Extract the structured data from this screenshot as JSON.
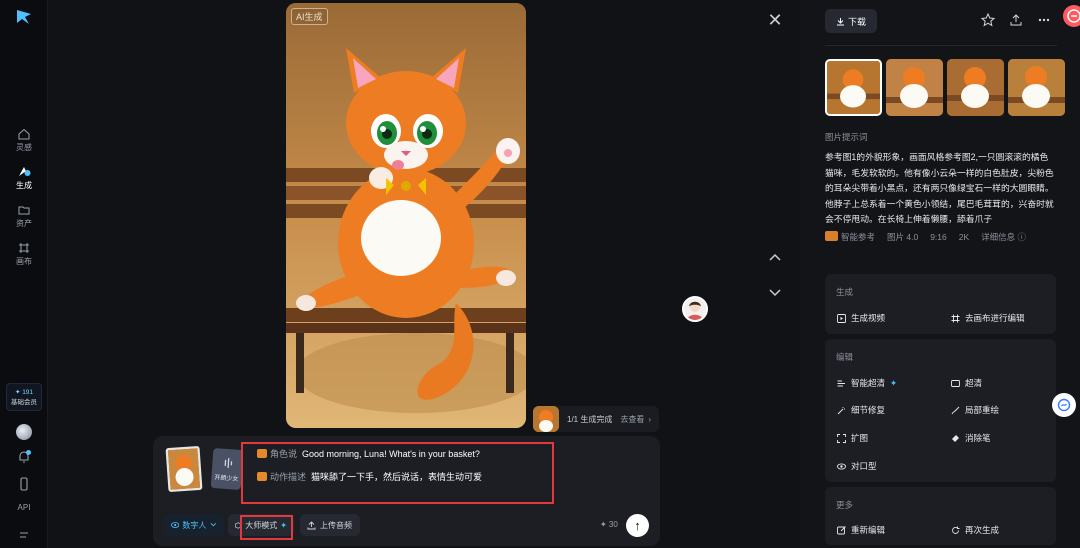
{
  "sidebar": {
    "items": [
      {
        "label": "灵感",
        "icon": "home-icon"
      },
      {
        "label": "生成",
        "icon": "generate-icon"
      },
      {
        "label": "资产",
        "icon": "folder-icon"
      },
      {
        "label": "画布",
        "icon": "canvas-icon"
      }
    ],
    "vip_points": "✦ 191",
    "vip_label": "基础会员",
    "api_label": "API"
  },
  "stage": {
    "ai_tag": "AI生成",
    "close_icon": "close-icon",
    "gen_status": {
      "text": "1/1 生成完成",
      "link": "去查看",
      "chevron": "›"
    }
  },
  "input_panel": {
    "audio_file_label": "开朗少女",
    "prompt_lines": [
      {
        "label": "角色说",
        "text": "Good morning, Luna! What's in your basket?"
      },
      {
        "label": "动作描述",
        "text": "猫咪舔了一下手，然后说话，表情生动可爱"
      }
    ],
    "buttons": {
      "digital_human": "数字人",
      "master_mode": "大师模式",
      "upload_audio": "上传音频"
    },
    "credits": "✦ 30",
    "send_icon": "↑"
  },
  "right_panel": {
    "download_label": "下载",
    "prompt_section_title": "图片提示词",
    "prompt_text": "参考图1的外貌形象，画面风格参考图2,一只圆滚滚的橘色猫咪，毛发软软的。他有像小云朵一样的白色肚皮，尖粉色的耳朵尖带着小黑点，还有两只像绿宝石一样的大圆眼睛。他脖子上总系着一个黄色小领结，尾巴毛茸茸的，兴奋时就会不停甩动。在长椅上伸着懒腰，舔着爪子",
    "meta": {
      "ref": "智能参考",
      "model": "图片 4.0",
      "ratio": "9:16",
      "resolution": "2K",
      "details": "详细信息"
    },
    "generate_card": {
      "title": "生成",
      "actions": [
        "生成视频",
        "去画布进行编辑"
      ]
    },
    "edit_card": {
      "title": "编辑",
      "actions": [
        "智能超清",
        "超清",
        "细节修复",
        "局部重绘",
        "扩图",
        "消除笔",
        "对口型"
      ]
    },
    "more_card": {
      "title": "更多",
      "actions": [
        "重新编辑",
        "再次生成"
      ]
    }
  }
}
